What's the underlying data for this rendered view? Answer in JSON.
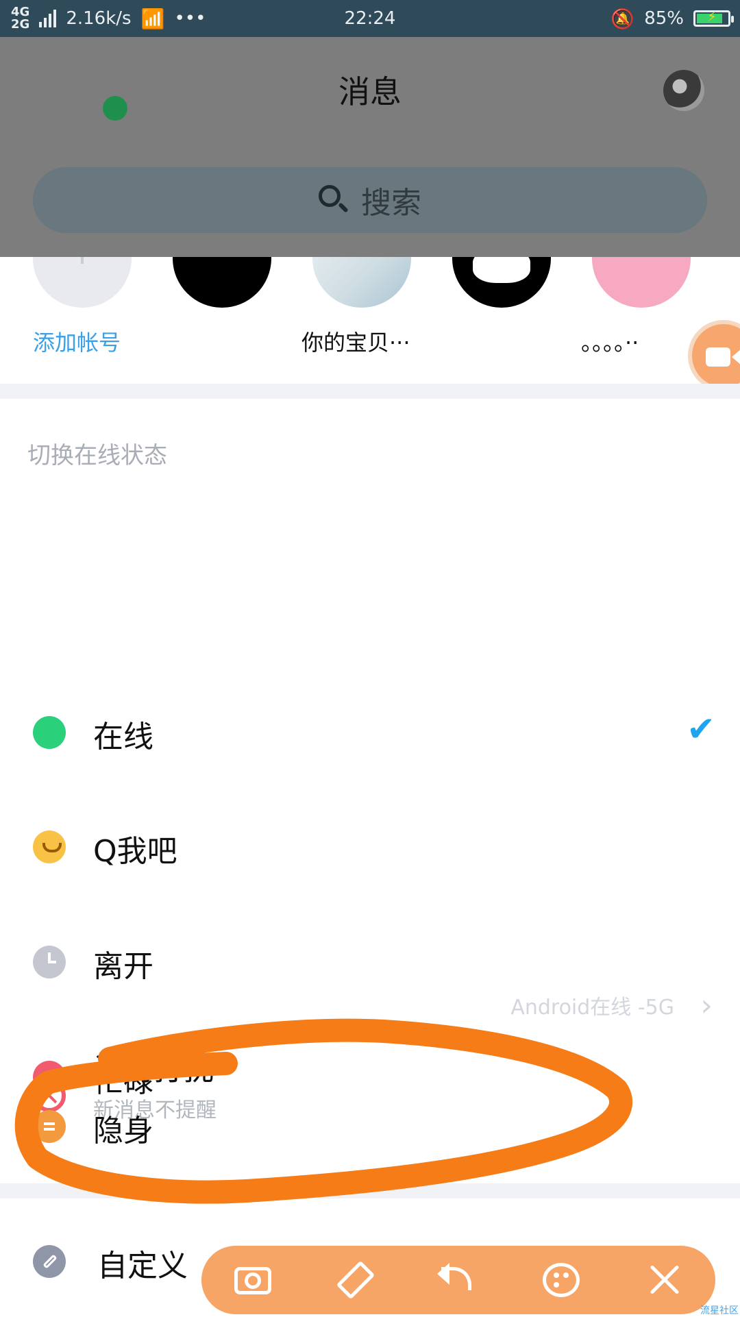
{
  "status_bar": {
    "network_top": "4G",
    "network_bottom": "2G",
    "speed": "2.16k/s",
    "more": "•••",
    "time": "22:24",
    "battery_percent": "85%",
    "battery_level": 0.85
  },
  "header": {
    "title": "消息",
    "search_placeholder": "搜索"
  },
  "accounts": [
    {
      "label": "添加帐号"
    },
    {
      "label": ""
    },
    {
      "label": "你的宝贝···"
    },
    {
      "label": ""
    },
    {
      "label": "。。。。··"
    }
  ],
  "section_title": "切换在线状态",
  "statuses": [
    {
      "label": "在线",
      "icon": "online-dot-icon",
      "selected": true
    },
    {
      "label": "Q我吧",
      "icon": "smile-icon"
    },
    {
      "label": "离开",
      "icon": "clock-icon"
    },
    {
      "label": "忙碌",
      "icon": "minus-icon"
    },
    {
      "label": "请勿打扰",
      "sub": "新消息不提醒",
      "icon": "no-entry-icon"
    },
    {
      "label": "隐身",
      "icon": "invisible-icon"
    }
  ],
  "custom": {
    "label": "自定义",
    "device_status": "Android在线 -5G"
  },
  "check_mark": "✔",
  "chevron": "›",
  "watermark": "流星社区",
  "colors": {
    "accent_blue": "#3aa0e8",
    "check_blue": "#1fa5ee",
    "annotation_orange": "#f57c17",
    "toolbar_orange": "#f7a566"
  }
}
